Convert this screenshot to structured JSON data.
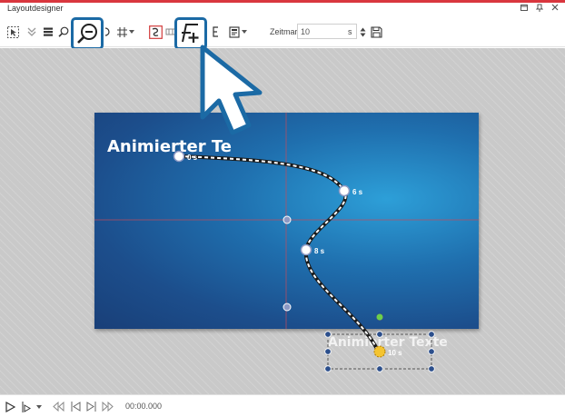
{
  "window": {
    "title": "Layoutdesigner"
  },
  "toolbar": {
    "zeitmarke_label": "Zeitmarke:",
    "zeitmarke_value": "10",
    "zeitmarke_unit": "s"
  },
  "canvas": {
    "slide_title": "Animierter Te",
    "ghost_text": "Animierter Texte",
    "keyframes": [
      {
        "label": "0 s"
      },
      {
        "label": "6 s"
      },
      {
        "label": "8 s"
      },
      {
        "label": "10 s"
      }
    ]
  },
  "playback": {
    "time": "00:00.000"
  },
  "colors": {
    "accent": "#1b6aa5",
    "top_line": "#d9363e",
    "slide_dark": "#193f78",
    "slide_light": "#2d9fd8"
  }
}
